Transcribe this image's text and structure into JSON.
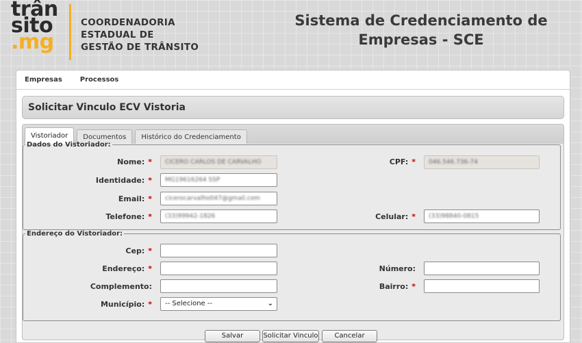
{
  "logo": {
    "line1": "trân",
    "line2": "sito",
    "line3": ".mg"
  },
  "org": {
    "line1": "COORDENADORIA",
    "line2": "ESTADUAL DE",
    "line3": "GESTÃO DE TRÂNSITO"
  },
  "system_title": {
    "line1": "Sistema de Credenciamento de",
    "line2": "Empresas - SCE"
  },
  "menu": {
    "items": [
      "Empresas",
      "Processos"
    ]
  },
  "page_title": "Solicitar Vinculo ECV Vistoria",
  "tabs": [
    {
      "label": "Vistoriador",
      "active": true
    },
    {
      "label": "Documentos",
      "active": false
    },
    {
      "label": "Histórico do Credenciamento",
      "active": false
    }
  ],
  "dados": {
    "legend": "Dados do Vistoriador:",
    "nome": {
      "label": "Nome:",
      "value": "CICERO CARLOS DE CARVALHO"
    },
    "cpf": {
      "label": "CPF:",
      "value": "046.546.736-74"
    },
    "identidade": {
      "label": "Identidade:",
      "value": "MG19616264 SSP"
    },
    "email": {
      "label": "Email:",
      "value": "cicerocarvalho047@gmail.com"
    },
    "telefone": {
      "label": "Telefone:",
      "value": "(33)99942-1826"
    },
    "celular": {
      "label": "Celular:",
      "value": "(33)98840-0815"
    }
  },
  "endereco": {
    "legend": "Endereço do Vistoriador:",
    "cep": {
      "label": "Cep:",
      "value": ""
    },
    "endereco": {
      "label": "Endereço:",
      "value": ""
    },
    "numero": {
      "label": "Número:",
      "value": ""
    },
    "complemento": {
      "label": "Complemento:",
      "value": ""
    },
    "bairro": {
      "label": "Bairro:",
      "value": ""
    },
    "municipio": {
      "label": "Município:",
      "selected": "-- Selecione --"
    }
  },
  "required_mark": "*",
  "buttons": {
    "save": "Salvar",
    "request": "Solicitar Vinculo",
    "cancel": "Cancelar"
  },
  "colors": {
    "accent": "#f4b021",
    "required": "#cc0000",
    "readonly_bg": "#e6e3df"
  }
}
